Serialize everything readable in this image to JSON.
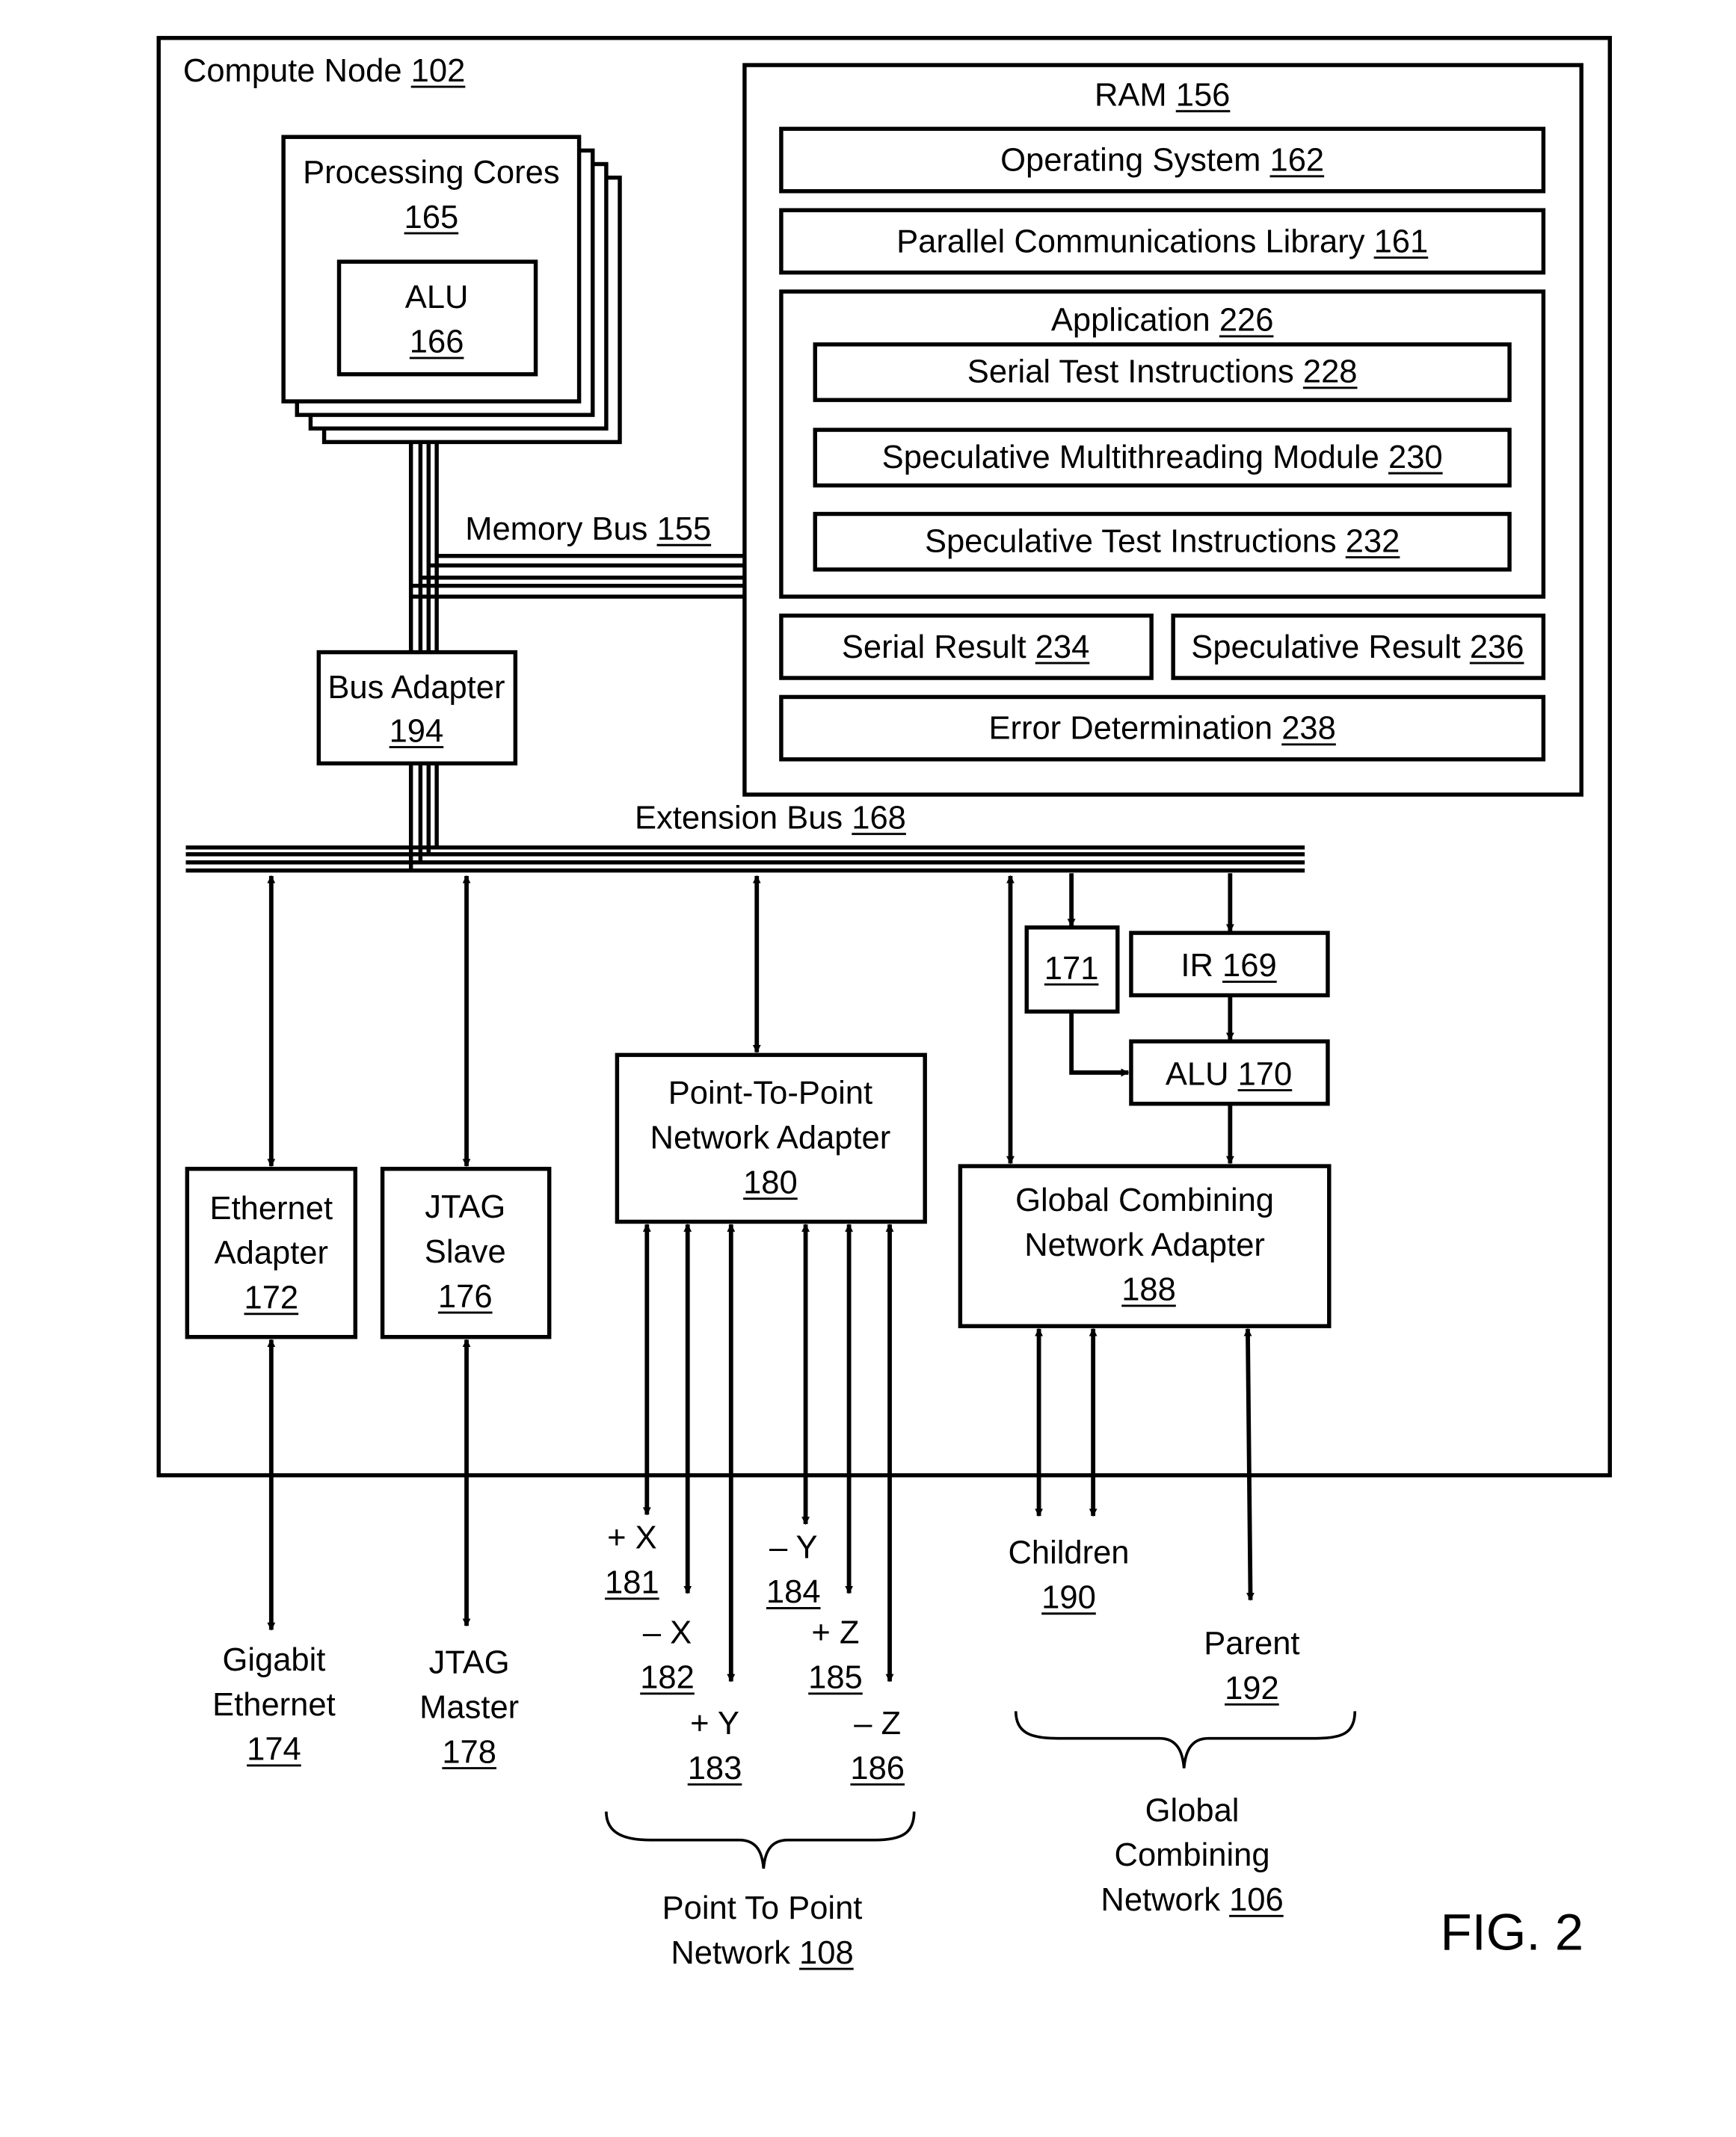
{
  "figure": {
    "label": "FIG. 2",
    "compute_node": {
      "label": "Compute Node",
      "ref": "102"
    },
    "ram": {
      "label": "RAM",
      "ref": "156",
      "operating_system": {
        "label": "Operating System",
        "ref": "162"
      },
      "parallel_comm_library": {
        "label": "Parallel Communications Library",
        "ref": "161"
      },
      "application": {
        "label": "Application",
        "ref": "226",
        "serial_test_instructions": {
          "label": "Serial Test Instructions",
          "ref": "228"
        },
        "speculative_multithreading_module": {
          "label": "Speculative Multithreading Module",
          "ref": "230"
        },
        "speculative_test_instructions": {
          "label": "Speculative Test Instructions",
          "ref": "232"
        }
      },
      "serial_result": {
        "label": "Serial Result",
        "ref": "234"
      },
      "speculative_result": {
        "label": "Speculative Result",
        "ref": "236"
      },
      "error_determination": {
        "label": "Error Determination",
        "ref": "238"
      }
    },
    "processing_cores": {
      "label": "Processing Cores",
      "ref": "165",
      "alu": {
        "label": "ALU",
        "ref": "166"
      }
    },
    "memory_bus": {
      "label": "Memory Bus",
      "ref": "155"
    },
    "bus_adapter": {
      "label": "Bus Adapter",
      "ref": "194"
    },
    "extension_bus": {
      "label": "Extension Bus",
      "ref": "168"
    },
    "ethernet_adapter": {
      "line1": "Ethernet",
      "line2": "Adapter",
      "ref": "172"
    },
    "jtag_slave": {
      "line1": "JTAG",
      "line2": "Slave",
      "ref": "176"
    },
    "p2p_adapter": {
      "line1": "Point-To-Point",
      "line2": "Network Adapter",
      "ref": "180"
    },
    "box_171": {
      "ref": "171"
    },
    "ir": {
      "label": "IR",
      "ref": "169"
    },
    "alu_170": {
      "label": "ALU",
      "ref": "170"
    },
    "gcn_adapter": {
      "line1": "Global Combining",
      "line2": "Network Adapter",
      "ref": "188"
    },
    "gigabit_ethernet": {
      "line1": "Gigabit",
      "line2": "Ethernet",
      "ref": "174"
    },
    "jtag_master": {
      "line1": "JTAG",
      "line2": "Master",
      "ref": "178"
    },
    "ports": [
      {
        "label": "+ X",
        "ref": "181"
      },
      {
        "label": "– X",
        "ref": "182"
      },
      {
        "label": "+ Y",
        "ref": "183"
      },
      {
        "label": "– Y",
        "ref": "184"
      },
      {
        "label": "+ Z",
        "ref": "185"
      },
      {
        "label": "– Z",
        "ref": "186"
      }
    ],
    "p2p_network": {
      "line1": "Point To Point",
      "line2": "Network",
      "ref": "108"
    },
    "children": {
      "label": "Children",
      "ref": "190"
    },
    "parent": {
      "label": "Parent",
      "ref": "192"
    },
    "gcn_network": {
      "line1": "Global",
      "line2": "Combining",
      "line3": "Network",
      "ref": "106"
    }
  }
}
